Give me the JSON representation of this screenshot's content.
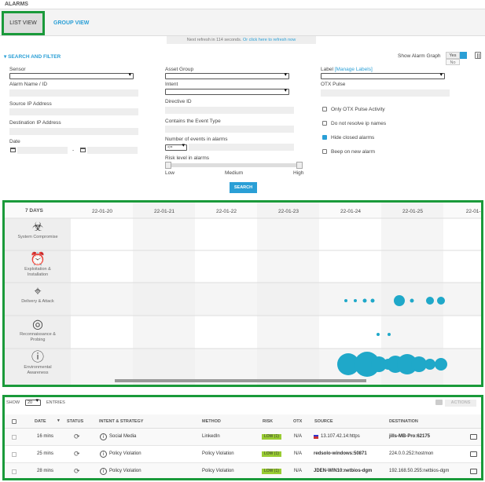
{
  "header": {
    "title": "ALARMS"
  },
  "tabs": {
    "list": "LIST VIEW",
    "group": "GROUP VIEW"
  },
  "refresh": {
    "text": "Next refresh in 114 seconds.",
    "link": "Or click here to refresh now"
  },
  "filter": {
    "section_title": "SEARCH AND FILTER",
    "sensor": "Sensor",
    "alarm_name": "Alarm Name / ID",
    "source_ip": "Source IP Address",
    "dest_ip": "Destination IP Address",
    "date": "Date",
    "date_sep": "-",
    "asset_group": "Asset Group",
    "intent": "Intent",
    "directive_id": "Directive ID",
    "event_type": "Contains the Event Type",
    "num_events": "Number of events in alarms",
    "num_events_op": "<=",
    "risk_level": "Risk level in alarms",
    "risk_low": "Low",
    "risk_medium": "Medium",
    "risk_high": "High",
    "label": "Label",
    "manage_labels": "[Manage Labels]",
    "otx_pulse": "OTX Pulse",
    "only_otx": "Only OTX Pulse Activity",
    "no_resolve": "Do not resolve ip names",
    "hide_closed": "Hide closed alarms",
    "beep": "Beep on new alarm",
    "show_graph": "Show Alarm Graph",
    "yes": "Yes",
    "no": "No",
    "search_btn": "SEARCH"
  },
  "graph": {
    "range_label": "7 DAYS",
    "dates": [
      "22-01-20",
      "22-01-21",
      "22-01-22",
      "22-01-23",
      "22-01-24",
      "22-01-25",
      "22-01-2"
    ],
    "categories": [
      {
        "label1": "System Compromise",
        "label2": "",
        "label3": "",
        "icon": "biohazard-icon"
      },
      {
        "label1": "Exploitation &",
        "label2": "Installation",
        "label3": "",
        "icon": "alarm-clock-icon"
      },
      {
        "label1": "Delivery & Attack",
        "label2": "",
        "label3": "",
        "icon": "crosshair-icon"
      },
      {
        "label1": "Reconnaissance &",
        "label2": "Probing",
        "label3": "",
        "icon": "radar-icon"
      },
      {
        "label1": "Environmental",
        "label2": "Awareness",
        "label3": "",
        "icon": "info-icon"
      }
    ]
  },
  "table": {
    "show": "SHOW",
    "entries_count": "20",
    "entries": "ENTRIES",
    "actions": "ACTIONS",
    "columns": [
      "DATE",
      "STATUS",
      "INTENT & STRATEGY",
      "METHOD",
      "RISK",
      "OTX",
      "SOURCE",
      "DESTINATION"
    ],
    "rows": [
      {
        "date": "16 mins",
        "intent": "Social Media",
        "method": "LinkedIn",
        "risk": "LOW (1)",
        "otx": "N/A",
        "source": "13.107.42.14:https",
        "destination": "jills-MB-Pro:62175"
      },
      {
        "date": "25 mins",
        "intent": "Policy Violation",
        "method": "Policy Violation",
        "risk": "LOW (1)",
        "otx": "N/A",
        "source": "redsolo-windows:50871",
        "destination": "224.0.0.252:hostmon"
      },
      {
        "date": "28 mins",
        "intent": "Policy Violation",
        "method": "Policy Violation",
        "risk": "LOW (1)",
        "otx": "N/A",
        "source": "JDEN-WIN10:netbios-dgm",
        "destination": "192.168.50.255:netbios-dgm"
      }
    ]
  },
  "colors": {
    "accent": "#2a9fd6",
    "green_outline": "#1a9a3a",
    "bubble": "#1fa8c9"
  }
}
